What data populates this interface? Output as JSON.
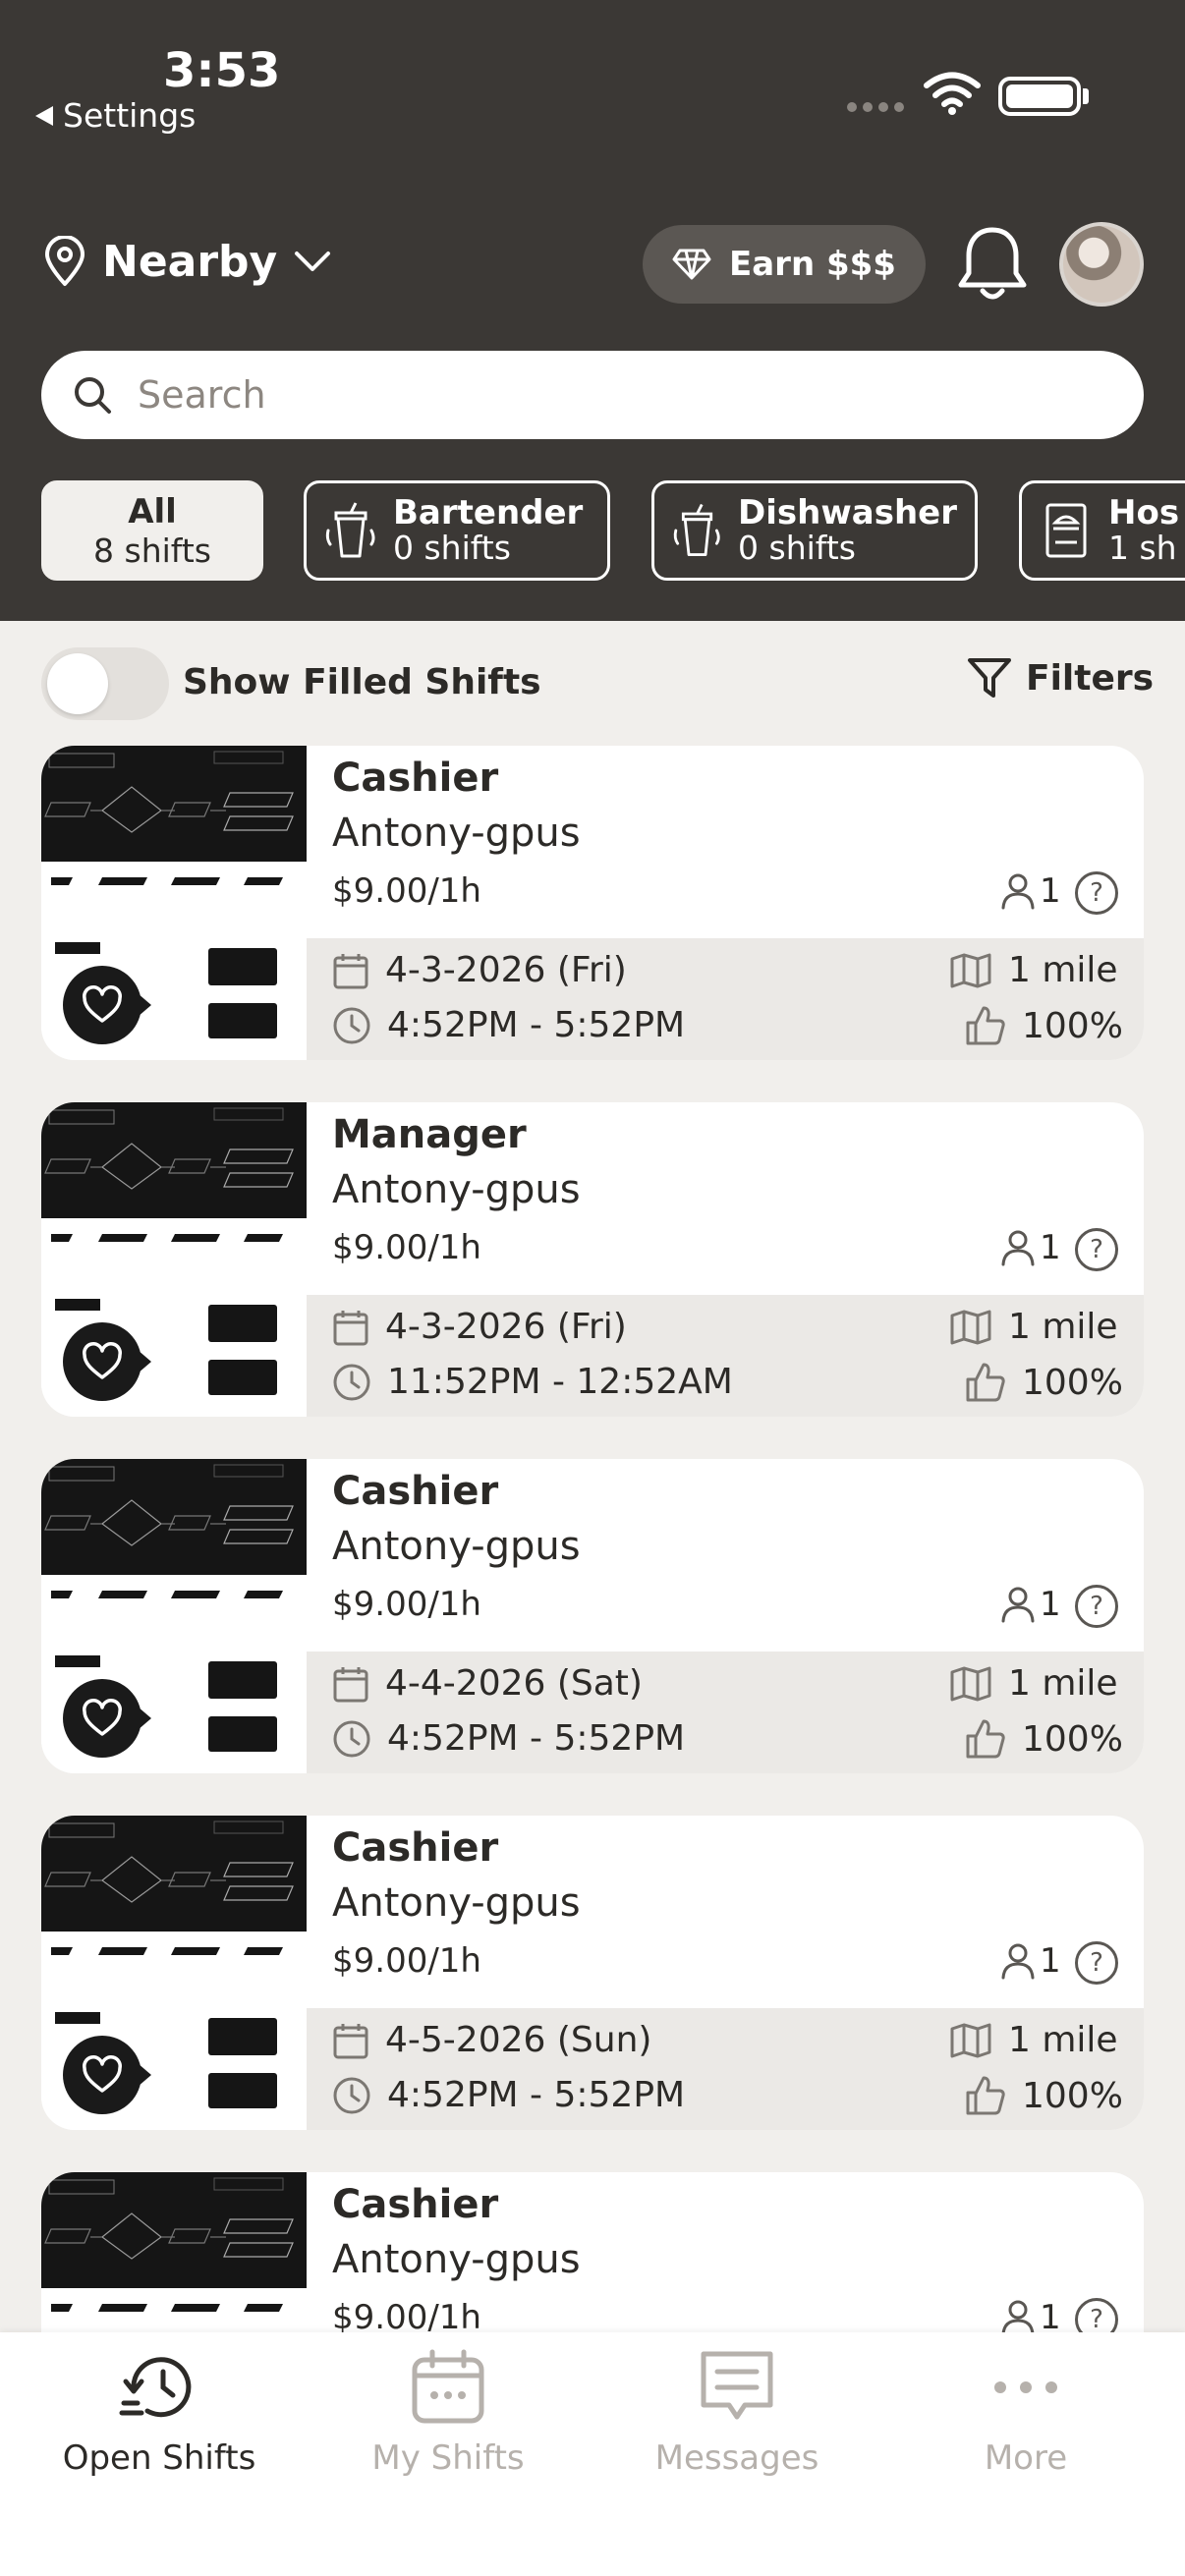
{
  "status_bar": {
    "time": "3:53",
    "back_label": "Settings"
  },
  "header": {
    "location_label": "Nearby",
    "earn_label": "Earn $$$",
    "search_placeholder": "Search"
  },
  "categories": [
    {
      "title": "All",
      "count": "8 shifts",
      "active": true
    },
    {
      "title": "Bartender",
      "count": "0 shifts",
      "icon": "cup-icon"
    },
    {
      "title": "Dishwasher",
      "count": "0 shifts",
      "icon": "cup-icon"
    },
    {
      "title": "Hos",
      "count": "1 sh",
      "icon": "menu-icon"
    }
  ],
  "filter_row": {
    "toggle_label": "Show Filled Shifts",
    "filters_label": "Filters"
  },
  "shifts": [
    {
      "title": "Cashier",
      "company": "Antony-gpus",
      "rate": "$9.00/1h",
      "people": "1",
      "date": "4-3-2026 (Fri)",
      "time": "4:52PM - 5:52PM",
      "distance": "1 mile",
      "rating": "100%"
    },
    {
      "title": "Manager",
      "company": "Antony-gpus",
      "rate": "$9.00/1h",
      "people": "1",
      "date": "4-3-2026 (Fri)",
      "time": "11:52PM - 12:52AM",
      "distance": "1 mile",
      "rating": "100%"
    },
    {
      "title": "Cashier",
      "company": "Antony-gpus",
      "rate": "$9.00/1h",
      "people": "1",
      "date": "4-4-2026 (Sat)",
      "time": "4:52PM - 5:52PM",
      "distance": "1 mile",
      "rating": "100%"
    },
    {
      "title": "Cashier",
      "company": "Antony-gpus",
      "rate": "$9.00/1h",
      "people": "1",
      "date": "4-5-2026 (Sun)",
      "time": "4:52PM - 5:52PM",
      "distance": "1 mile",
      "rating": "100%"
    },
    {
      "title": "Cashier",
      "company": "Antony-gpus",
      "rate": "$9.00/1h",
      "people": "1"
    }
  ],
  "tabs": [
    {
      "label": "Open Shifts",
      "icon": "clock-history-icon",
      "active": true
    },
    {
      "label": "My Shifts",
      "icon": "calendar-icon"
    },
    {
      "label": "Messages",
      "icon": "message-icon"
    },
    {
      "label": "More",
      "icon": "more-icon"
    }
  ],
  "colors": {
    "header_bg": "#3b3835",
    "page_bg": "#f1efec",
    "accent_dark": "#2c2a27",
    "inactive_tab": "#b6b1ac"
  }
}
